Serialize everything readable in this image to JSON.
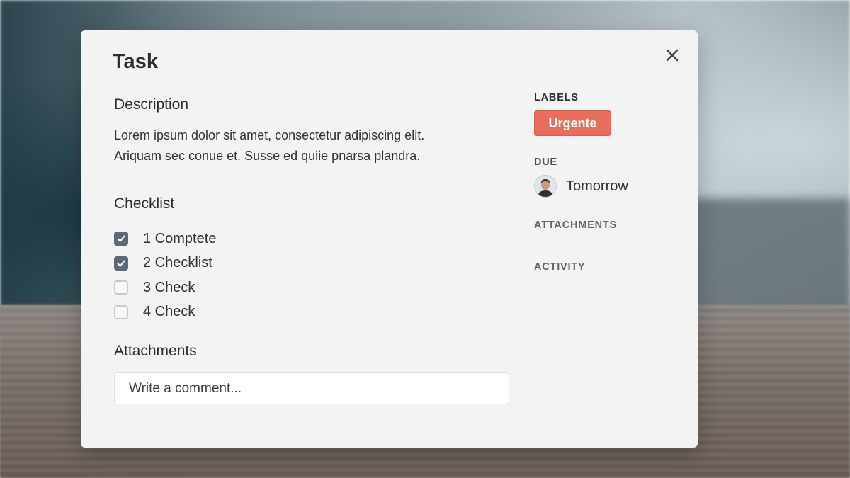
{
  "modal": {
    "title": "Task",
    "close_icon": "close-icon"
  },
  "description": {
    "heading": "Description",
    "line1": "Lorem ipsum dolor sit amet, consectetur adipiscing elit.",
    "line2": "Ariquam sec conue et. Susse ed quiie pnarsa plandra."
  },
  "checklist": {
    "heading": "Checklist",
    "items": [
      {
        "label": "1 Comptete",
        "checked": true
      },
      {
        "label": "2 Checklist",
        "checked": true
      },
      {
        "label": "3 Check",
        "checked": false
      },
      {
        "label": "4 Check",
        "checked": false
      }
    ],
    "checkmark_icon": "checkmark-icon"
  },
  "attachments": {
    "heading": "Attachments",
    "comment_placeholder": "Write a comment..."
  },
  "sidebar": {
    "labels_heading": "LABELS",
    "label_badge": "Urgente",
    "label_color": "#e96c5d",
    "due_heading": "DUE",
    "due_value": "Tomorrow",
    "avatar_icon": "user-avatar",
    "attachments_heading": "ATTACHMENTS",
    "activity_heading": "ACTIVITY"
  },
  "colors": {
    "checkbox_checked": "#5b6878",
    "modal_background": "#f3f3f3"
  }
}
